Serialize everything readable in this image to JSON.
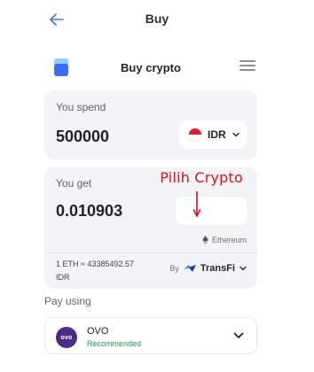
{
  "header": {
    "title": "Buy"
  },
  "widget": {
    "title": "Buy crypto"
  },
  "spend": {
    "label": "You spend",
    "amount": "500000",
    "currency": "IDR"
  },
  "get": {
    "label": "You get",
    "amount": "0.010903",
    "network": "Ethereum",
    "rate": "1 ETH ≈ 43385492.57 IDR",
    "provider_prefix": "By",
    "provider": "TransFi"
  },
  "annotation": {
    "text": "Pilih Crypto"
  },
  "payment": {
    "label": "Pay using",
    "method": "OVO",
    "tag": "Recommended"
  },
  "colors": {
    "accent": "#4f6ef7",
    "annotation": "#e0101b",
    "recommended": "#16a34a",
    "ovo": "#4c2a86"
  },
  "icons": [
    "back-arrow-icon",
    "brand-logo-icon",
    "menu-icon",
    "indonesia-flag-icon",
    "chevron-down-icon",
    "ethereum-icon",
    "transfi-logo-icon",
    "ovo-logo-icon"
  ]
}
